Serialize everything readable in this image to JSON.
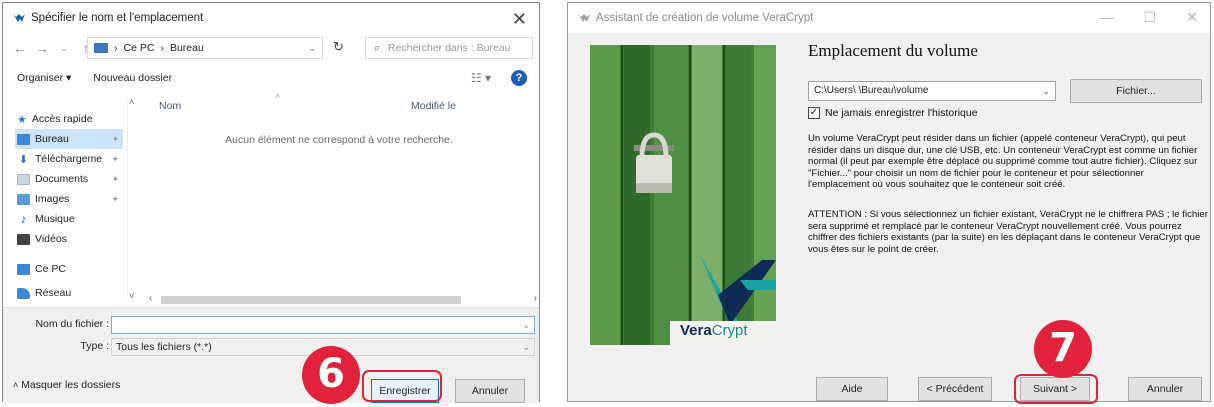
{
  "save_dialog": {
    "title": "Spécifier le nom et l'emplacement",
    "breadcrumb": [
      "Ce PC",
      "Bureau"
    ],
    "search_placeholder": "Rechercher dans : Bureau",
    "toolbar": {
      "organize": "Organiser ▾",
      "new_folder": "Nouveau dossier"
    },
    "nav_items": [
      {
        "label": "Accès rapide",
        "icon": "star-icon",
        "color": "#2c7bd6"
      },
      {
        "label": "Bureau",
        "icon": "desktop-folder-icon",
        "color": "#3b86d8",
        "selected": true
      },
      {
        "label": "Téléchargeme",
        "icon": "download-icon",
        "color": "#2b6fbf"
      },
      {
        "label": "Documents",
        "icon": "documents-icon",
        "color": "#9fb6cf"
      },
      {
        "label": "Images",
        "icon": "images-icon",
        "color": "#5b9bd5"
      },
      {
        "label": "Musique",
        "icon": "music-icon",
        "color": "#2b5797"
      },
      {
        "label": "Vidéos",
        "icon": "video-icon",
        "color": "#444444"
      },
      {
        "label": "Ce PC",
        "icon": "computer-icon",
        "color": "#3b86d8"
      },
      {
        "label": "Réseau",
        "icon": "network-icon",
        "color": "#3b86d8"
      }
    ],
    "columns": {
      "name": "Nom",
      "modified": "Modifié le"
    },
    "empty_message": "Aucun élément ne correspond à votre recherche.",
    "filename_label": "Nom du fichier :",
    "filename_value": "",
    "type_label": "Type :",
    "type_value": "Tous les fichiers (*.*)",
    "hide_folders": "Masquer les dossiers",
    "save_button": "Enregistrer",
    "cancel_button": "Annuler",
    "step_badge": "6"
  },
  "vc_wizard": {
    "title": "Assistant de création de volume VeraCrypt",
    "heading": "Emplacement du volume",
    "path_value": "C:\\Users\\                         \\Bureau\\volume",
    "file_button": "Fichier...",
    "never_save_history": "Ne jamais enregistrer l'historique",
    "paragraph1": "Un volume VeraCrypt peut résider dans un fichier (appelé conteneur VeraCrypt), qui peut résider dans un disque dur, une clé USB, etc. Un conteneur VeraCrypt est comme un fichier normal (il peut par exemple être déplacé ou supprimé comme tout autre fichier). Cliquez sur \"Fichier...\" pour choisir un nom de fichier pour le conteneur et pour sélectionner l'emplacement où vous souhaitez que le conteneur soit créé.",
    "paragraph2": "ATTENTION : Si vous sélectionnez un fichier existant, VeraCrypt ne le chiffrera PAS ; le fichier sera supprimé et remplacé par le conteneur VeraCrypt nouvellement créé. Vous pourrez chiffrer des fichiers existants (par la suite) en les déplaçant dans le conteneur VeraCrypt que vous êtes sur le point de créer.",
    "logo_vera": "Vera",
    "logo_crypt": "Crypt",
    "buttons": {
      "help": "Aide",
      "previous": "< Précédent",
      "next": "Suivant >",
      "cancel": "Annuler"
    },
    "step_badge": "7"
  },
  "colors": {
    "callout_red": "#e2223a",
    "selection_blue": "#cce4f7",
    "primary_blue": "#0078d7"
  }
}
